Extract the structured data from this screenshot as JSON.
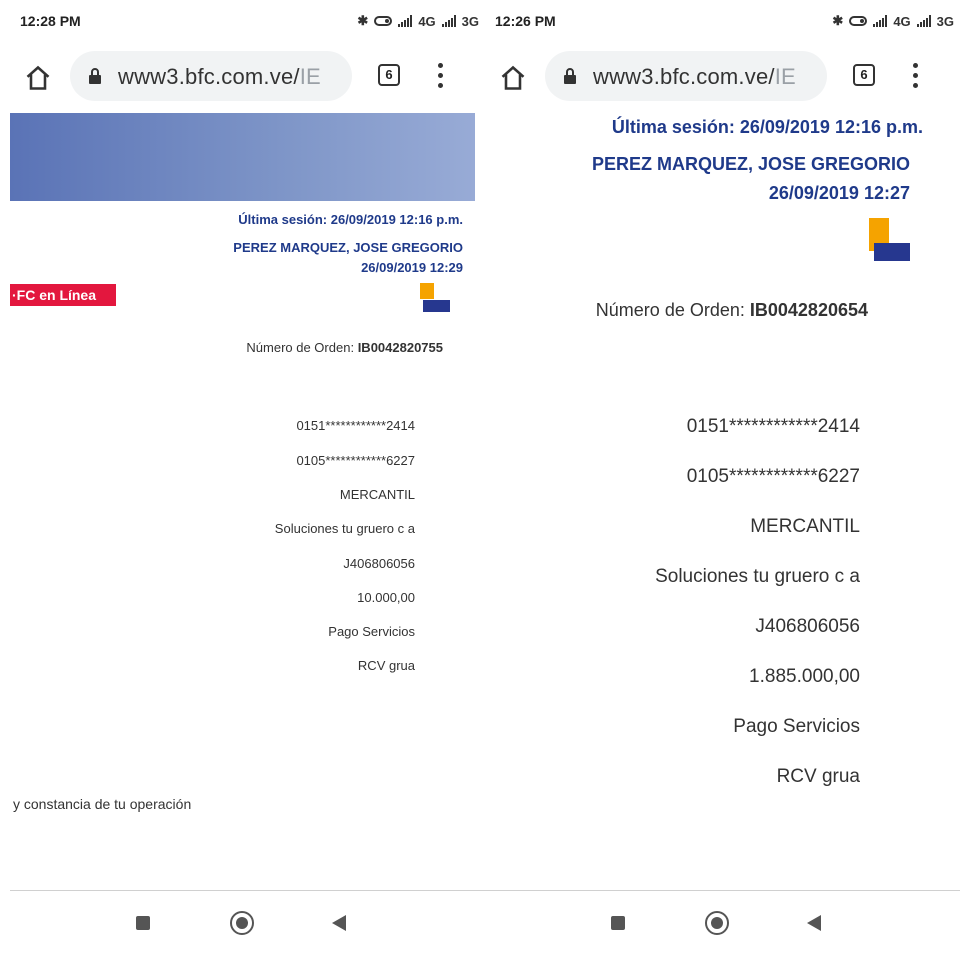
{
  "left": {
    "status_time": "12:28 PM",
    "network_4g": "4G",
    "network_3g": "3G",
    "url_text": "www3.bfc.com.ve/",
    "url_fade": "IE",
    "tab_count": "6",
    "session_line": "Última sesión: 26/09/2019 12:16 p.m.",
    "user_name": "PEREZ MARQUEZ, JOSE GREGORIO",
    "timestamp": "26/09/2019 12:29",
    "online_tab": "·FC en Línea",
    "order_label": "Número de Orden:",
    "order_number": "IB0042820755",
    "details": [
      "0151************2414",
      "0105************6227",
      "MERCANTIL",
      "Soluciones tu gruero c a",
      "J406806056",
      "10.000,00",
      "Pago Servicios",
      "RCV grua"
    ],
    "footer_text": "y constancia de tu operación"
  },
  "right": {
    "status_time": "12:26 PM",
    "network_4g": "4G",
    "network_3g": "3G",
    "url_text": "www3.bfc.com.ve/",
    "url_fade": "IE",
    "tab_count": "6",
    "session_line": "Última sesión: 26/09/2019 12:16 p.m.",
    "user_name": "PEREZ MARQUEZ, JOSE GREGORIO",
    "timestamp": "26/09/2019 12:27",
    "order_label": "Número de Orden:",
    "order_number": "IB0042820654",
    "details": [
      "0151************2414",
      "0105************6227",
      "MERCANTIL",
      "Soluciones tu gruero c a",
      "J406806056",
      "1.885.000,00",
      "Pago Servicios",
      "RCV grua"
    ]
  },
  "colors": {
    "brand_blue": "#1f3a8a",
    "logo_yellow": "#f5a300",
    "logo_blue": "#26378f",
    "online_red": "#e3173e"
  }
}
